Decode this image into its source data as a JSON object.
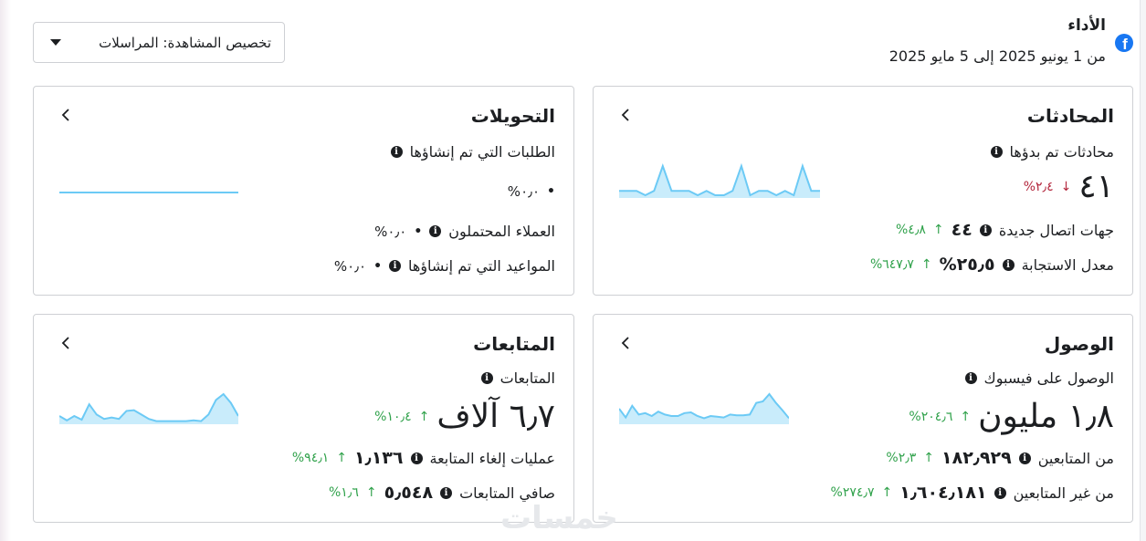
{
  "header": {
    "title": "الأداء",
    "date_range": "من 1 يونيو 2025 إلى 5 مايو 2025",
    "icon": "facebook-icon"
  },
  "view_selector": {
    "label": "تخصيص المشاهدة: المراسلات"
  },
  "cards": {
    "conversations": {
      "title": "المحادثات",
      "metric_label": "محادثات تم بدؤها",
      "value": "٤١",
      "change": "٢٫٤%",
      "change_direction": "down",
      "rows": [
        {
          "label": "جهات اتصال جديدة",
          "value": "٤٤",
          "change": "٤٫٨%",
          "direction": "up"
        },
        {
          "label": "معدل الاستجابة",
          "value": "٢٥٫٥%",
          "change": "٦٤٧٫٧%",
          "direction": "up"
        }
      ],
      "sparkline": [
        1.0,
        1.0,
        1.0,
        0.3,
        1.0,
        5.0,
        1.0,
        1.0,
        1.0,
        0.3,
        1.0,
        0.3,
        0.3,
        1.0,
        5.0,
        0.3,
        1.0,
        1.0,
        0.3,
        1.0,
        0.3,
        5.0,
        1.0,
        1.0
      ]
    },
    "conversions": {
      "title": "التحويلات",
      "metric_label": "الطلبات التي تم إنشاؤها",
      "value": "•",
      "change": "٠٫٠%",
      "rows": [
        {
          "label": "العملاء المحتملون",
          "value": "•",
          "change": "٠٫٠%"
        },
        {
          "label": "المواعيد التي تم إنشاؤها",
          "value": "•",
          "change": "٠٫٠%"
        }
      ],
      "sparkline": [
        0,
        0
      ]
    },
    "reach": {
      "title": "الوصول",
      "metric_label": "الوصول على فيسبوك",
      "value": "١٫٨ مليون",
      "change": "٢٠٤٫٦%",
      "change_direction": "up",
      "rows": [
        {
          "label": "من المتابعين",
          "value": "١٨٢٫٩٢٩",
          "change": "٢٫٣%",
          "direction": "up"
        },
        {
          "label": "من غير المتابعين",
          "value": "١٫٦٠٤٫١٨١",
          "change": "٢٧٤٫٧%",
          "direction": "up"
        }
      ],
      "sparkline": [
        2.0,
        0.8,
        2.4,
        1.2,
        1.4,
        1.0,
        1.6,
        1.2,
        1.0,
        1.0,
        1.4,
        1.5,
        1.0,
        0.7,
        1.0,
        0.9,
        0.8,
        1.2,
        1.1,
        1.1,
        1.2,
        2.8,
        3.0,
        4.0,
        2.8,
        1.8,
        0.7
      ]
    },
    "followers": {
      "title": "المتابعات",
      "metric_label": "المتابعات",
      "value": "٦٫٧ آلاف",
      "change": "١٠٫٤%",
      "change_direction": "up",
      "rows": [
        {
          "label": "عمليات إلغاء المتابعة",
          "value": "١٫١٣٦",
          "change": "٩٤٫١%",
          "direction": "up"
        },
        {
          "label": "صافي المتابعات",
          "value": "٥٫٥٤٨",
          "change": "١٫٦%",
          "direction": "up"
        }
      ],
      "sparkline": [
        1.0,
        0.4,
        1.0,
        0.5,
        2.6,
        1.2,
        0.6,
        0.8,
        0.6,
        1.7,
        1.8,
        1.2,
        0.6,
        0.3,
        0.3,
        0.3,
        0.3,
        0.3,
        0.4,
        0.3,
        1.2,
        3.2,
        4.0,
        2.8,
        1.0
      ]
    }
  },
  "colors": {
    "accent": "#1877f2",
    "up": "#31a24c",
    "down": "#b3273d",
    "spark_line": "#6ccaf5",
    "spark_fill": "#c9ecfb"
  },
  "watermark": "خمسات"
}
